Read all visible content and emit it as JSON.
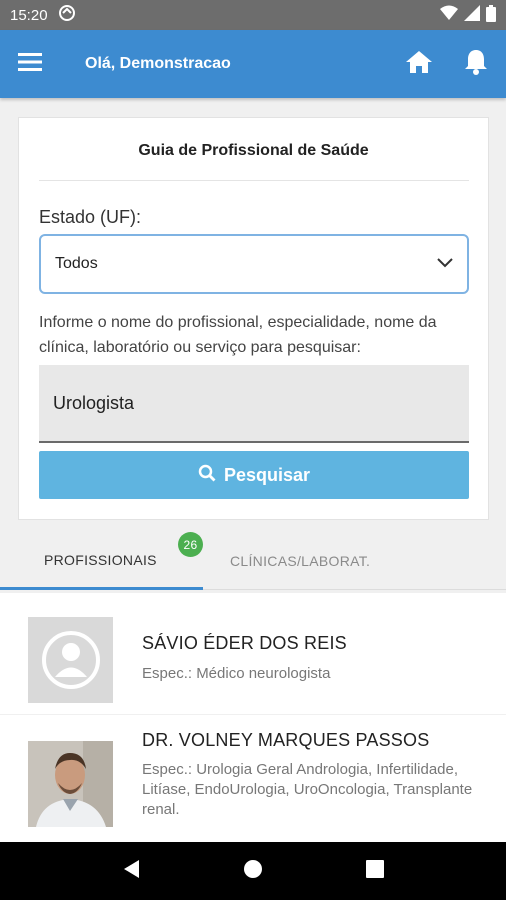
{
  "status": {
    "time": "15:20"
  },
  "header": {
    "greeting": "Olá, Demonstracao"
  },
  "card": {
    "title": "Guia de Profissional de Saúde",
    "state_label": "Estado (UF):",
    "state_value": "Todos",
    "hint": "Informe o nome do profissional, especialidade, nome da clínica, laboratório ou serviço para pesquisar:",
    "search_value": "Urologista",
    "search_button": "Pesquisar"
  },
  "tabs": [
    {
      "label": "PROFISSIONAIS",
      "badge": "26"
    },
    {
      "label": "CLÍNICAS/LABORAT."
    }
  ],
  "results": [
    {
      "name": "SÁVIO ÉDER DOS REIS",
      "spec": "Espec.: Médico neurologista"
    },
    {
      "name": "DR. VOLNEY MARQUES PASSOS",
      "spec": "Espec.: Urologia Geral Andrologia, Infertilidade, Litíase, EndoUrologia, UroOncologia, Transplante renal."
    }
  ],
  "colors": {
    "primary": "#3d8bd0",
    "button": "#5fb4e0",
    "badge": "#4caf50"
  },
  "icons": [
    "menu-icon",
    "home-icon",
    "bell-icon",
    "search-icon",
    "chevron-down-icon",
    "back-icon",
    "home-circle-icon",
    "recents-icon"
  ]
}
